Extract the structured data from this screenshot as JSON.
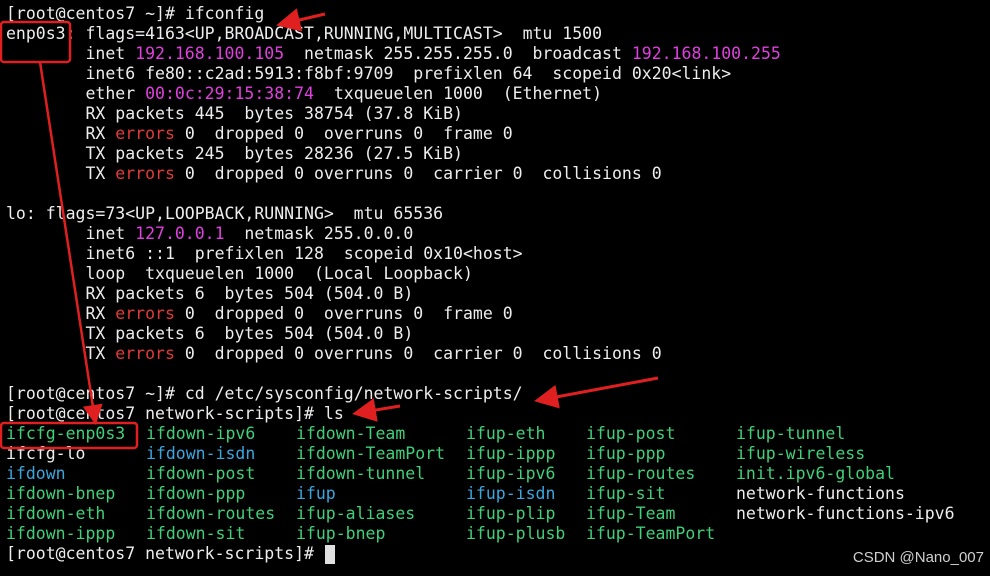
{
  "terminal": {
    "cmd1": {
      "prompt": "[root@centos7 ~]# ",
      "command": "ifconfig"
    },
    "enp0s3": {
      "name": "enp0s3:",
      "flags": " flags=4163<UP,BROADCAST,RUNNING,MULTICAST>  mtu 1500",
      "inet_label": "        inet ",
      "inet": "192.168.100.105",
      "netmask": "  netmask 255.255.255.0  broadcast ",
      "broadcast": "192.168.100.255",
      "inet6": "        inet6 fe80::c2ad:5913:f8bf:9709  prefixlen 64  scopeid 0x20<link>",
      "ether_label": "        ether ",
      "ether": "00:0c:29:15:38:74",
      "ether_rest": "  txqueuelen 1000  (Ethernet)",
      "rx_packets": "        RX packets 445  bytes 38754 (37.8 KiB)",
      "rx_errors_pre": "        RX ",
      "rx_errors_word": "errors",
      "rx_errors_rest": " 0  dropped 0  overruns 0  frame 0",
      "tx_packets": "        TX packets 245  bytes 28236 (27.5 KiB)",
      "tx_errors_pre": "        TX ",
      "tx_errors_word": "errors",
      "tx_errors_rest": " 0  dropped 0 overruns 0  carrier 0  collisions 0"
    },
    "lo": {
      "flags": "lo: flags=73<UP,LOOPBACK,RUNNING>  mtu 65536",
      "inet_label": "        inet ",
      "inet": "127.0.0.1",
      "netmask": "  netmask 255.0.0.0",
      "inet6": "        inet6 ::1  prefixlen 128  scopeid 0x10<host>",
      "loop": "        loop  txqueuelen 1000  (Local Loopback)",
      "rx_packets": "        RX packets 6  bytes 504 (504.0 B)",
      "rx_errors_pre": "        RX ",
      "rx_errors_word": "errors",
      "rx_errors_rest": " 0  dropped 0  overruns 0  frame 0",
      "tx_packets": "        TX packets 6  bytes 504 (504.0 B)",
      "tx_errors_pre": "        TX ",
      "tx_errors_word": "errors",
      "tx_errors_rest": " 0  dropped 0 overruns 0  carrier 0  collisions 0"
    },
    "cmd2": {
      "prompt": "[root@centos7 ~]# ",
      "command": "cd /etc/sysconfig/network-scripts/"
    },
    "cmd3": {
      "prompt": "[root@centos7 network-scripts]# ",
      "command": "ls"
    },
    "ls_files": [
      [
        "ifcfg-enp0s3",
        "ifdown-ipv6",
        "ifdown-Team",
        "ifup-eth",
        "ifup-post",
        "ifup-tunnel"
      ],
      [
        "ifcfg-lo",
        "ifdown-isdn",
        "ifdown-TeamPort",
        "ifup-ippp",
        "ifup-ppp",
        "ifup-wireless"
      ],
      [
        "ifdown",
        "ifdown-post",
        "ifdown-tunnel",
        "ifup-ipv6",
        "ifup-routes",
        "init.ipv6-global"
      ],
      [
        "ifdown-bnep",
        "ifdown-ppp",
        "ifup",
        "ifup-isdn",
        "ifup-sit",
        "network-functions"
      ],
      [
        "ifdown-eth",
        "ifdown-routes",
        "ifup-aliases",
        "ifup-plip",
        "ifup-Team",
        "network-functions-ipv6"
      ],
      [
        "ifdown-ippp",
        "ifdown-sit",
        "ifup-bnep",
        "ifup-plusb",
        "ifup-TeamPort",
        ""
      ]
    ],
    "ls_colors": [
      [
        "g",
        "g",
        "g",
        "g",
        "g",
        "g"
      ],
      [
        "w",
        "b",
        "g",
        "g",
        "g",
        "g"
      ],
      [
        "b",
        "g",
        "g",
        "g",
        "g",
        "g"
      ],
      [
        "g",
        "g",
        "b",
        "b",
        "g",
        "w"
      ],
      [
        "g",
        "g",
        "g",
        "g",
        "g",
        "w"
      ],
      [
        "g",
        "g",
        "g",
        "g",
        "g",
        "w"
      ]
    ],
    "cmd4": {
      "prompt": "[root@centos7 network-scripts]# "
    }
  },
  "watermark": "CSDN @Nano_007",
  "colors": {
    "background": "#000000",
    "text": "#ededed",
    "ip_magenta": "#e040e0",
    "error_red": "#e23a3a",
    "exec_green": "#3fd07a",
    "symlink_blue": "#3aa6de",
    "annotation_red": "#e02020"
  }
}
